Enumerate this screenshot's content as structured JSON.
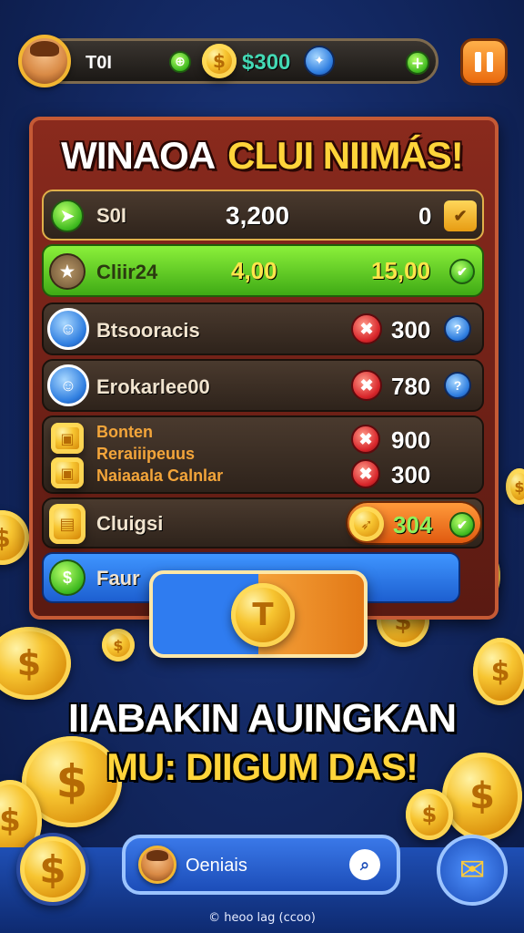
{
  "top_bar": {
    "player_label": "T0I",
    "currency_amount": "$300",
    "left_gem_icon": "green-gem-icon",
    "dollar_coin_icon": "dollar-coin-icon",
    "world_icon": "globe-icon",
    "add_icon": "plus-icon",
    "pause_icon": "pause-icon"
  },
  "title": {
    "part1": "WINAOA",
    "part2": "CLUI NIIMÁS!"
  },
  "rows": [
    {
      "label": "S0I",
      "value": "3,200",
      "value2": "0",
      "icon": "green-arrow-icon",
      "action_icon": "gold-check-icon"
    },
    {
      "label": "Cliir24",
      "value": "4,00",
      "value2": "15,00",
      "icon": "star-badge-icon",
      "action_icon": "green-check-icon"
    },
    {
      "label": "Btsooracis",
      "value": "300",
      "icon": "character-portrait-icon",
      "action_icon": "red-x-icon",
      "info_icon": "blue-info-icon"
    },
    {
      "label": "Erokarlee00",
      "value": "780",
      "icon": "character-portrait-icon",
      "action_icon": "red-x-icon",
      "info_icon": "blue-info-icon"
    },
    {
      "label_lines": [
        "Bonten",
        "Reraiiipeuus",
        "Naiaaala Calnlar"
      ],
      "values": [
        "900",
        "300"
      ],
      "icon": "treasure-icon",
      "action_icon": "red-x-icon"
    },
    {
      "label": "Cluigsi",
      "value": "304",
      "icon": "treasure-chest-icon",
      "action_icon": "green-check-icon"
    },
    {
      "label": "Faur",
      "icon": "green-dollar-icon"
    }
  ],
  "center_button": {
    "coin_letter": "T",
    "icon": "gold-coin-button-icon"
  },
  "promo": {
    "line1": "IIABAKIN AUINGKAN",
    "line2": "MU: DIIGUM DAS!"
  },
  "bottom": {
    "left_icon": "dollar-coin-icon",
    "search_label": "Oeniais",
    "search_icon": "search-icon",
    "right_icon": "envelope-icon",
    "footer_text": "© heoo lag (ccoo)"
  },
  "colors": {
    "background": "#142a66",
    "board": "#8a2a1d",
    "accent_gold": "#ffd43a",
    "green_row": "#52c81b",
    "blue_row": "#2a7be6"
  }
}
